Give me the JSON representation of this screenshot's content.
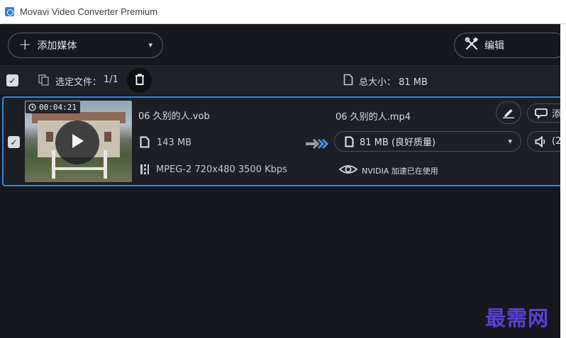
{
  "window": {
    "title": "Movavi Video Converter Premium"
  },
  "toolbar": {
    "add_media_label": "添加媒体",
    "edit_label": "编辑"
  },
  "selection": {
    "selected_label": "选定文件：",
    "selected_count": "1/1",
    "total_label": "总大小：  81 MB"
  },
  "file": {
    "checked": true,
    "duration": "00:04:21",
    "source_name": "06 久别的人.vob",
    "source_size": "143 MB",
    "source_meta": "MPEG-2 720x480 3500 Kbps",
    "output_name": "06 久别的人.mp4",
    "output_format": "81 MB (良好质量)",
    "hardware_accel": "NVIDIA 加速已在使用",
    "subtitle_label": "添",
    "audio_label": "(2"
  },
  "watermark": "最需网",
  "icons": {
    "app": "movavi-app-icon",
    "add": "plus-icon",
    "edit": "tools-icon",
    "files": "files-icon",
    "delete": "trash-icon",
    "document": "document-icon",
    "timer": "clock-icon",
    "play": "play-icon",
    "film": "film-icon",
    "convert": "double-arrow-icon",
    "nvidia": "nvidia-icon",
    "pen": "pen-icon",
    "subtitle": "speech-bubble-icon",
    "audio": "speaker-icon",
    "dropdown": "chevron-down-icon"
  },
  "colors": {
    "background": "#16181d",
    "selection_border": "#2f87e0",
    "arrow": "#4a8fe8",
    "watermark": "#5b3fd6"
  }
}
